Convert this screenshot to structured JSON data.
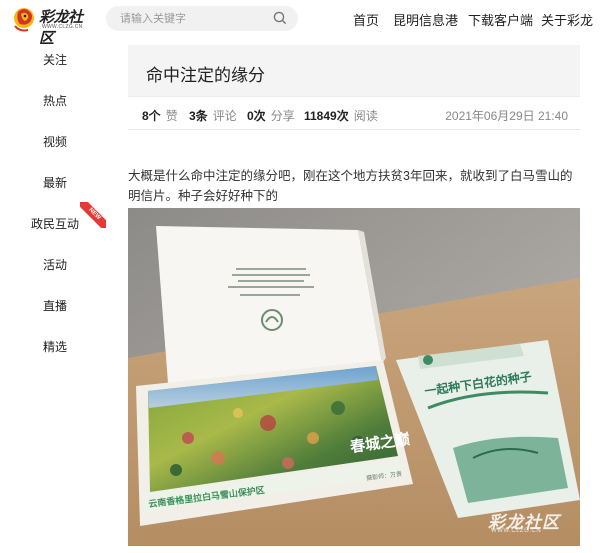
{
  "header": {
    "logo_text": "彩龙社区",
    "logo_sub": "WWW.CLZG.CN",
    "search_placeholder": "请输入关键字",
    "nav": [
      "首页",
      "昆明信息港",
      "下载客户端",
      "关于彩龙"
    ]
  },
  "sidebar": {
    "items": [
      {
        "label": "关注"
      },
      {
        "label": "热点"
      },
      {
        "label": "视频"
      },
      {
        "label": "最新"
      },
      {
        "label": "政民互动",
        "badge": "NEW"
      },
      {
        "label": "活动"
      },
      {
        "label": "直播"
      },
      {
        "label": "精选"
      }
    ]
  },
  "article": {
    "title": "命中注定的缘分",
    "likes": "8个",
    "likes_unit": "赞",
    "comments": "3条",
    "comments_unit": "评论",
    "shares": "0次",
    "shares_unit": "分享",
    "reads": "11849次",
    "reads_unit": "阅读",
    "date": "2021年06月29日 21:40",
    "body": "大概是什么命中注定的缘分吧，刚在这个地方扶贫3年回来，就收到了白马雪山的明信片。种子会好好种下的",
    "photo": {
      "card_caption": "云南香格里拉白马雪山保护区",
      "card_stamp": "春城之巅",
      "photographer": "摄影师：万贵",
      "booklet_title": "一起种下白花的种子",
      "watermark": "彩龙社区",
      "watermark_sub": "WWW.CLZG.CN"
    }
  },
  "colors": {
    "accent": "#e53935",
    "title_bg": "#f4f4f4",
    "muted": "#888888"
  }
}
